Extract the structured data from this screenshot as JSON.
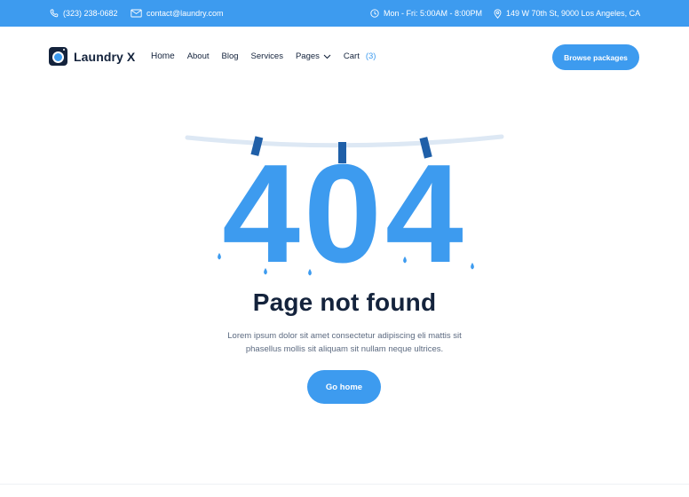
{
  "topbar": {
    "phone": "(323) 238-0682",
    "email": "contact@laundry.com",
    "hours": "Mon - Fri: 5:00AM - 8:00PM",
    "address": "149 W 70th St, 9000 Los Angeles, CA"
  },
  "brand": {
    "name": "Laundry X"
  },
  "nav": {
    "items": [
      {
        "label": "Home"
      },
      {
        "label": "About"
      },
      {
        "label": "Blog"
      },
      {
        "label": "Services"
      },
      {
        "label": "Pages"
      },
      {
        "label": "Cart"
      }
    ],
    "cart_count": "(3)",
    "cta_label": "Browse packages"
  },
  "error": {
    "code": "404",
    "title": "Page not found",
    "description": "Lorem ipsum dolor sit amet consectetur adipiscing eli mattis sit phasellus mollis sit aliquam sit nullam neque ultrices.",
    "button_label": "Go home"
  },
  "colors": {
    "accent": "#3d9bef",
    "dark": "#14233c",
    "clip": "#1f5fa8",
    "line": "#dde8f4"
  },
  "icons": [
    "phone-icon",
    "mail-icon",
    "clock-icon",
    "location-icon",
    "chevron-down-icon",
    "washing-machine-icon"
  ]
}
